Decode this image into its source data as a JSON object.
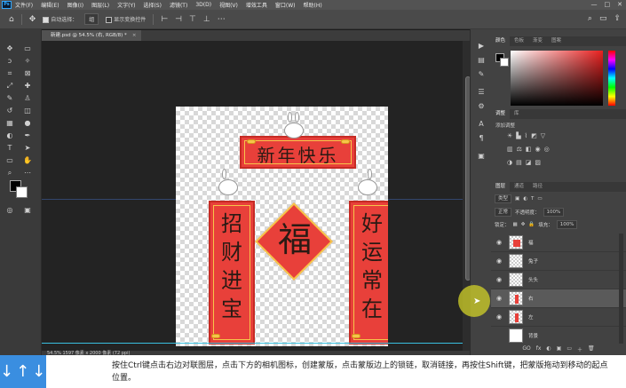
{
  "app": {
    "logo": "Ps"
  },
  "menubar": {
    "items": [
      "文件(F)",
      "编辑(E)",
      "图像(I)",
      "图层(L)",
      "文字(Y)",
      "选择(S)",
      "滤镜(T)",
      "3D(D)",
      "视图(V)",
      "增效工具",
      "窗口(W)",
      "帮助(H)"
    ],
    "window_controls": [
      "—",
      "□",
      "✕"
    ]
  },
  "options": {
    "auto_select_label": "自动选择：",
    "auto_select_target": "组",
    "show_transform_label": "显示变换控件"
  },
  "document": {
    "tab_label": "新建.psd @ 54.5% (右, RGB/8) *",
    "close": "×"
  },
  "canvas_art": {
    "top_banner": "新年快乐",
    "left_scroll": "招财进宝",
    "right_scroll": "好运常在",
    "center": "福"
  },
  "status": {
    "text": "54.5%   1597 像素 x 2000 像素 (72 ppi)"
  },
  "panels": {
    "color_tabs": [
      "颜色",
      "色板",
      "渐变",
      "图案"
    ],
    "adjust_tabs": [
      "调整",
      "库"
    ],
    "adjust_label": "添加调整",
    "layer_tabs": [
      "图层",
      "通道",
      "路径"
    ],
    "filter_kind": "类型",
    "blend_mode": "正常",
    "opacity_label": "不透明度：",
    "opacity_value": "100%",
    "lock_label": "锁定：",
    "fill_label": "填充：",
    "fill_value": "100%",
    "layers": [
      {
        "name": "福",
        "selected": false
      },
      {
        "name": "兔子",
        "selected": false
      },
      {
        "name": "头头",
        "selected": false
      },
      {
        "name": "右",
        "selected": true
      },
      {
        "name": "左",
        "selected": false
      },
      {
        "name": "背景",
        "selected": false
      }
    ],
    "footer_icons": [
      "GO",
      "fx",
      "◐",
      "▣",
      "▭",
      "＋",
      "🗑"
    ]
  },
  "caption": {
    "arrows": "↓↑↓",
    "text": "按住Ctrl键点击右边对联图层，点击下方的相机图标，创建蒙版，点击蒙版边上的锁链，取消链接，再按住Shift键，把蒙版拖动到移动的起点位置。"
  },
  "colors": {
    "red": "#e8403a",
    "gold": "#f6c54a",
    "highlight": "#d2d228"
  }
}
